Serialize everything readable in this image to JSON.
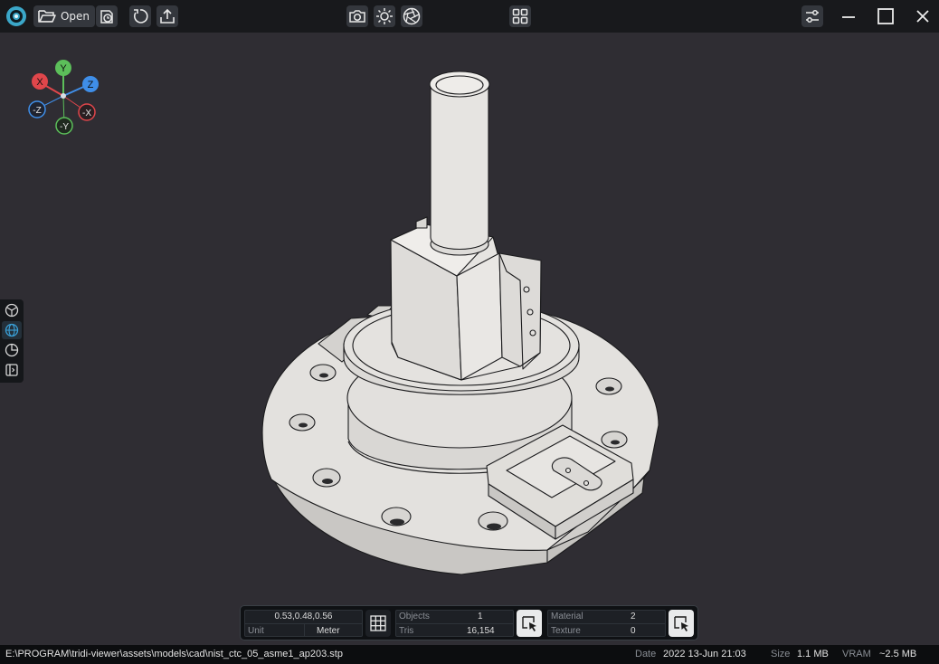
{
  "toolbar": {
    "open_label": "Open",
    "icons": [
      "app-logo-icon",
      "folder-open-icon",
      "history-icon",
      "reset-icon",
      "export-icon",
      "camera-icon",
      "light-icon",
      "aperture-icon",
      "layout-grid-icon",
      "settings-sliders-icon",
      "minimize-icon",
      "maximize-icon",
      "close-icon"
    ]
  },
  "gizmo": {
    "x": "X",
    "y": "Y",
    "z": "Z",
    "neg_x": "-X",
    "neg_y": "-Y",
    "neg_z": "-Z",
    "colors": {
      "x": "#e0464b",
      "y": "#5cbf5a",
      "z": "#3f8ee8"
    }
  },
  "sidebar": {
    "icons": [
      "model-icon",
      "globe-icon",
      "pie-chart-icon",
      "panel-toggle-icon"
    ]
  },
  "stats": {
    "coords": "0.53,0.48,0.56",
    "unit_label": "Unit",
    "unit_value": "Meter",
    "objects_label": "Objects",
    "objects_value": "1",
    "tris_label": "Tris",
    "tris_value": "16,154",
    "material_label": "Material",
    "material_value": "2",
    "texture_label": "Texture",
    "texture_value": "0"
  },
  "status": {
    "path": "E:\\PROGRAM\\tridi-viewer\\assets\\models\\cad\\nist_ctc_05_asme1_ap203.stp",
    "date_label": "Date",
    "date_value": "2022 13-Jun 21:03",
    "size_label": "Size",
    "size_value": "1.1 MB",
    "vram_label": "VRAM",
    "vram_value": "~2.5 MB"
  },
  "colors": {
    "background": "#2f2d33",
    "model": "#e3e1de",
    "accent": "#3aa0d8"
  }
}
